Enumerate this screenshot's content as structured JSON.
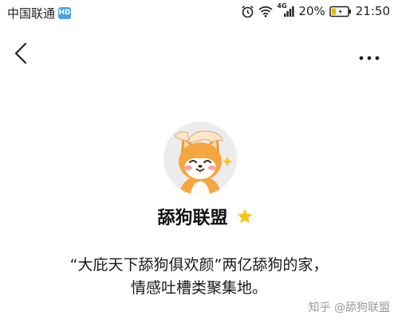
{
  "status_bar": {
    "carrier": "中国联通",
    "hd_badge": "HD",
    "network_type": "4G",
    "battery_percent": "20%",
    "time": "21:50"
  },
  "nav": {
    "back_icon": "chevron-left-icon",
    "more_icon": "more-horizontal-icon"
  },
  "profile": {
    "avatar_icon": "shiba-dog-avatar",
    "name": "舔狗联盟",
    "badge_icon": "star-icon",
    "badge_color": "#f5c518",
    "description_line1": "“大庇天下舔狗俱欢颜”两亿舔狗的家，",
    "description_line2": "情感吐槽类聚集地。"
  },
  "watermark": "知乎 @舔狗联盟"
}
